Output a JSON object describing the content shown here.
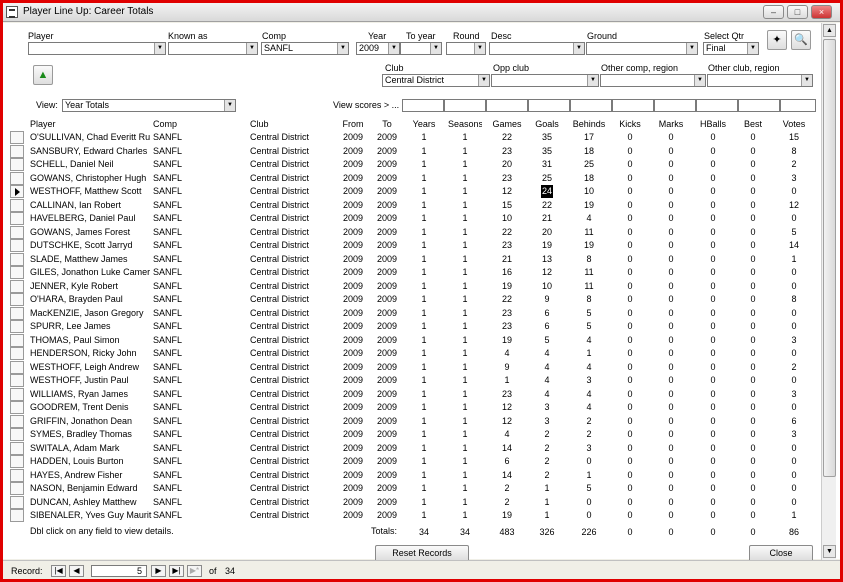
{
  "window": {
    "title": "Player Line Up: Career Totals"
  },
  "filters": {
    "player": {
      "label": "Player",
      "value": ""
    },
    "known_as": {
      "label": "Known as",
      "value": ""
    },
    "comp": {
      "label": "Comp",
      "value": "SANFL"
    },
    "year": {
      "label": "Year",
      "value": "2009"
    },
    "to_year": {
      "label": "To year",
      "value": ""
    },
    "round": {
      "label": "Round",
      "value": ""
    },
    "desc": {
      "label": "Desc",
      "value": ""
    },
    "ground": {
      "label": "Ground",
      "value": ""
    },
    "select_qtr": {
      "label": "Select Qtr",
      "value": "Final"
    },
    "club": {
      "label": "Club",
      "value": "Central District"
    },
    "opp_club": {
      "label": "Opp club",
      "value": ""
    },
    "other_comp": {
      "label": "Other comp, region",
      "value": ""
    },
    "other_club": {
      "label": "Other club, region",
      "value": ""
    },
    "view": {
      "label": "View:",
      "value": "Year Totals"
    },
    "view_scores": {
      "label": "View scores > ..."
    }
  },
  "columns": [
    "Player",
    "Comp",
    "Club",
    "From",
    "To",
    "Years",
    "Seasons",
    "Games",
    "Goals",
    "Behinds",
    "Kicks",
    "Marks",
    "HBalls",
    "Best",
    "Votes"
  ],
  "rows": [
    [
      "O'SULLIVAN, Chad Everitt Ru",
      "SANFL",
      "Central District",
      "2009",
      "2009",
      "1",
      "1",
      "22",
      "35",
      "17",
      "0",
      "0",
      "0",
      "0",
      "15"
    ],
    [
      "SANSBURY, Edward Charles",
      "SANFL",
      "Central District",
      "2009",
      "2009",
      "1",
      "1",
      "23",
      "35",
      "18",
      "0",
      "0",
      "0",
      "0",
      "8"
    ],
    [
      "SCHELL, Daniel Neil",
      "SANFL",
      "Central District",
      "2009",
      "2009",
      "1",
      "1",
      "20",
      "31",
      "25",
      "0",
      "0",
      "0",
      "0",
      "2"
    ],
    [
      "GOWANS, Christopher Hugh",
      "SANFL",
      "Central District",
      "2009",
      "2009",
      "1",
      "1",
      "23",
      "25",
      "18",
      "0",
      "0",
      "0",
      "0",
      "3"
    ],
    [
      "WESTHOFF, Matthew Scott",
      "SANFL",
      "Central District",
      "2009",
      "2009",
      "1",
      "1",
      "12",
      "24",
      "10",
      "0",
      "0",
      "0",
      "0",
      "0"
    ],
    [
      "CALLINAN, Ian Robert",
      "SANFL",
      "Central District",
      "2009",
      "2009",
      "1",
      "1",
      "15",
      "22",
      "19",
      "0",
      "0",
      "0",
      "0",
      "12"
    ],
    [
      "HAVELBERG, Daniel Paul",
      "SANFL",
      "Central District",
      "2009",
      "2009",
      "1",
      "1",
      "10",
      "21",
      "4",
      "0",
      "0",
      "0",
      "0",
      "0"
    ],
    [
      "GOWANS, James Forest",
      "SANFL",
      "Central District",
      "2009",
      "2009",
      "1",
      "1",
      "22",
      "20",
      "11",
      "0",
      "0",
      "0",
      "0",
      "5"
    ],
    [
      "DUTSCHKE, Scott Jarryd",
      "SANFL",
      "Central District",
      "2009",
      "2009",
      "1",
      "1",
      "23",
      "19",
      "19",
      "0",
      "0",
      "0",
      "0",
      "14"
    ],
    [
      "SLADE, Matthew James",
      "SANFL",
      "Central District",
      "2009",
      "2009",
      "1",
      "1",
      "21",
      "13",
      "8",
      "0",
      "0",
      "0",
      "0",
      "1"
    ],
    [
      "GILES, Jonathon Luke Camer",
      "SANFL",
      "Central District",
      "2009",
      "2009",
      "1",
      "1",
      "16",
      "12",
      "11",
      "0",
      "0",
      "0",
      "0",
      "0"
    ],
    [
      "JENNER, Kyle Robert",
      "SANFL",
      "Central District",
      "2009",
      "2009",
      "1",
      "1",
      "19",
      "10",
      "11",
      "0",
      "0",
      "0",
      "0",
      "0"
    ],
    [
      "O'HARA, Brayden Paul",
      "SANFL",
      "Central District",
      "2009",
      "2009",
      "1",
      "1",
      "22",
      "9",
      "8",
      "0",
      "0",
      "0",
      "0",
      "8"
    ],
    [
      "MacKENZIE, Jason Gregory",
      "SANFL",
      "Central District",
      "2009",
      "2009",
      "1",
      "1",
      "23",
      "6",
      "5",
      "0",
      "0",
      "0",
      "0",
      "0"
    ],
    [
      "SPURR, Lee James",
      "SANFL",
      "Central District",
      "2009",
      "2009",
      "1",
      "1",
      "23",
      "6",
      "5",
      "0",
      "0",
      "0",
      "0",
      "0"
    ],
    [
      "THOMAS, Paul Simon",
      "SANFL",
      "Central District",
      "2009",
      "2009",
      "1",
      "1",
      "19",
      "5",
      "4",
      "0",
      "0",
      "0",
      "0",
      "3"
    ],
    [
      "HENDERSON, Ricky John",
      "SANFL",
      "Central District",
      "2009",
      "2009",
      "1",
      "1",
      "4",
      "4",
      "1",
      "0",
      "0",
      "0",
      "0",
      "0"
    ],
    [
      "WESTHOFF, Leigh Andrew",
      "SANFL",
      "Central District",
      "2009",
      "2009",
      "1",
      "1",
      "9",
      "4",
      "4",
      "0",
      "0",
      "0",
      "0",
      "2"
    ],
    [
      "WESTHOFF, Justin Paul",
      "SANFL",
      "Central District",
      "2009",
      "2009",
      "1",
      "1",
      "1",
      "4",
      "3",
      "0",
      "0",
      "0",
      "0",
      "0"
    ],
    [
      "WILLIAMS, Ryan James",
      "SANFL",
      "Central District",
      "2009",
      "2009",
      "1",
      "1",
      "23",
      "4",
      "4",
      "0",
      "0",
      "0",
      "0",
      "3"
    ],
    [
      "GOODREM, Trent Denis",
      "SANFL",
      "Central District",
      "2009",
      "2009",
      "1",
      "1",
      "12",
      "3",
      "4",
      "0",
      "0",
      "0",
      "0",
      "0"
    ],
    [
      "GRIFFIN, Jonathon Dean",
      "SANFL",
      "Central District",
      "2009",
      "2009",
      "1",
      "1",
      "12",
      "3",
      "2",
      "0",
      "0",
      "0",
      "0",
      "6"
    ],
    [
      "SYMES, Bradley Thomas",
      "SANFL",
      "Central District",
      "2009",
      "2009",
      "1",
      "1",
      "4",
      "2",
      "2",
      "0",
      "0",
      "0",
      "0",
      "3"
    ],
    [
      "SWITALA, Adam Mark",
      "SANFL",
      "Central District",
      "2009",
      "2009",
      "1",
      "1",
      "14",
      "2",
      "3",
      "0",
      "0",
      "0",
      "0",
      "0"
    ],
    [
      "HADDEN, Louis Burton",
      "SANFL",
      "Central District",
      "2009",
      "2009",
      "1",
      "1",
      "6",
      "2",
      "0",
      "0",
      "0",
      "0",
      "0",
      "0"
    ],
    [
      "HAYES, Andrew Fisher",
      "SANFL",
      "Central District",
      "2009",
      "2009",
      "1",
      "1",
      "14",
      "2",
      "1",
      "0",
      "0",
      "0",
      "0",
      "0"
    ],
    [
      "NASON, Benjamin Edward",
      "SANFL",
      "Central District",
      "2009",
      "2009",
      "1",
      "1",
      "2",
      "1",
      "5",
      "0",
      "0",
      "0",
      "0",
      "0"
    ],
    [
      "DUNCAN, Ashley Matthew",
      "SANFL",
      "Central District",
      "2009",
      "2009",
      "1",
      "1",
      "2",
      "1",
      "0",
      "0",
      "0",
      "0",
      "0",
      "0"
    ],
    [
      "SIBENALER, Yves Guy Maurit",
      "SANFL",
      "Central District",
      "2009",
      "2009",
      "1",
      "1",
      "19",
      "1",
      "0",
      "0",
      "0",
      "0",
      "0",
      "1"
    ]
  ],
  "current_row": 4,
  "footer": {
    "hint": "Dbl click on any field to view details.",
    "totals_label": "Totals:",
    "totals": [
      "34",
      "34",
      "483",
      "326",
      "226",
      "0",
      "0",
      "0",
      "0",
      "86"
    ],
    "reset_label": "Reset Records",
    "close_label": "Close"
  },
  "navigation": {
    "record_label": "Record:",
    "current": "5",
    "of_label": "of",
    "total": "34"
  },
  "icons": [
    "app-icon",
    "minimize-icon",
    "maximize-icon",
    "close-icon",
    "magic-wand-icon",
    "preview-icon",
    "shield-icon"
  ]
}
